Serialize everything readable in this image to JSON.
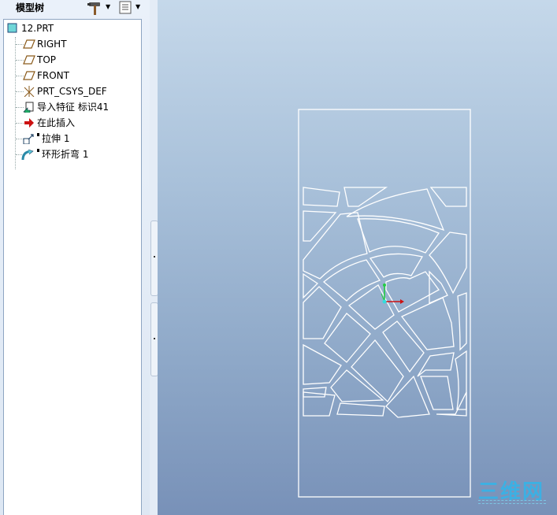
{
  "panel": {
    "title": "模型树"
  },
  "tree": {
    "root": "12.PRT",
    "items": [
      {
        "label": "RIGHT",
        "icon": "datum-plane-icon"
      },
      {
        "label": "TOP",
        "icon": "datum-plane-icon"
      },
      {
        "label": "FRONT",
        "icon": "datum-plane-icon"
      },
      {
        "label": "PRT_CSYS_DEF",
        "icon": "coordinate-system-icon"
      },
      {
        "label": "导入特征 标识41",
        "icon": "import-feature-icon"
      },
      {
        "label": "在此插入",
        "icon": "insert-here-arrow-icon"
      },
      {
        "label": "拉伸 1",
        "icon": "extrude-icon"
      },
      {
        "label": "环形折弯 1",
        "icon": "toroidal-bend-icon"
      }
    ]
  },
  "watermark": "三维网",
  "colors": {
    "accent_arrow": "#cc1111",
    "viewport_top": "#c5d8ea",
    "viewport_bottom": "#7891b8",
    "sketch_lines": "#ffffff"
  }
}
